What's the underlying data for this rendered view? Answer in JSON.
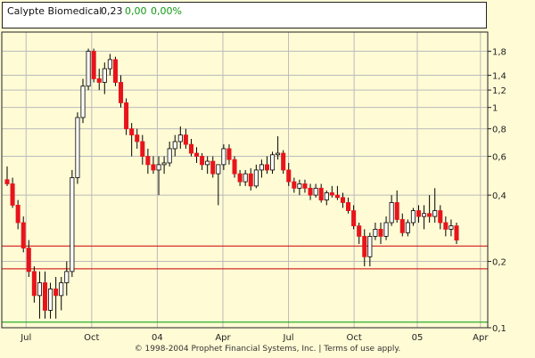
{
  "header": {
    "name": "Calypte Biomedical",
    "price": "0,23",
    "change": "0,00",
    "percent": "0,00%"
  },
  "footer": {
    "copyright": "© 1998-2004 Prophet Financial Systems, Inc. | Terms of use apply."
  },
  "colors": {
    "background": "#fffbd5",
    "up": "#ffffff",
    "down": "#e8141b",
    "gridline": "#bbbbbb",
    "red_line": "#cc0000",
    "green_line": "#009900"
  },
  "chart_data": {
    "type": "candlestick",
    "y_scale": "log",
    "ylim": [
      0.1,
      2.2
    ],
    "y_ticks": [
      {
        "v": 1.8,
        "label": "1,8"
      },
      {
        "v": 1.4,
        "label": "1,4"
      },
      {
        "v": 1.2,
        "label": "1,2"
      },
      {
        "v": 1,
        "label": "1"
      },
      {
        "v": 0.8,
        "label": "0,8"
      },
      {
        "v": 0.6,
        "label": "0,6"
      },
      {
        "v": 0.4,
        "label": "0,4"
      },
      {
        "v": 0.2,
        "label": "0,2"
      },
      {
        "v": 0.1,
        "label": "0,1"
      }
    ],
    "x_ticks": [
      {
        "pos": 0.05,
        "label": "Jul"
      },
      {
        "pos": 0.185,
        "label": "Oct"
      },
      {
        "pos": 0.32,
        "label": "04"
      },
      {
        "pos": 0.455,
        "label": "Apr"
      },
      {
        "pos": 0.59,
        "label": "Jul"
      },
      {
        "pos": 0.725,
        "label": "Oct"
      },
      {
        "pos": 0.855,
        "label": "05"
      },
      {
        "pos": 0.985,
        "label": "Apr"
      }
    ],
    "hlines": [
      {
        "value": 0.235,
        "color": "#cc0000"
      },
      {
        "value": 0.185,
        "color": "#cc0000"
      },
      {
        "value": 0.106,
        "color": "#009900"
      }
    ],
    "candles": [
      [
        0.47,
        0.54,
        0.44,
        0.45
      ],
      [
        0.45,
        0.48,
        0.35,
        0.36
      ],
      [
        0.36,
        0.38,
        0.28,
        0.3
      ],
      [
        0.3,
        0.32,
        0.22,
        0.23
      ],
      [
        0.23,
        0.25,
        0.17,
        0.18
      ],
      [
        0.18,
        0.19,
        0.13,
        0.14
      ],
      [
        0.14,
        0.18,
        0.11,
        0.16
      ],
      [
        0.16,
        0.18,
        0.11,
        0.12
      ],
      [
        0.12,
        0.16,
        0.11,
        0.15
      ],
      [
        0.15,
        0.17,
        0.11,
        0.14
      ],
      [
        0.14,
        0.17,
        0.12,
        0.16
      ],
      [
        0.16,
        0.2,
        0.14,
        0.18
      ],
      [
        0.18,
        0.52,
        0.17,
        0.48
      ],
      [
        0.48,
        0.95,
        0.45,
        0.9
      ],
      [
        0.9,
        1.35,
        0.85,
        1.25
      ],
      [
        1.25,
        1.85,
        1.2,
        1.8
      ],
      [
        1.8,
        1.85,
        1.3,
        1.35
      ],
      [
        1.35,
        1.5,
        1.2,
        1.3
      ],
      [
        1.3,
        1.6,
        1.15,
        1.5
      ],
      [
        1.5,
        1.75,
        1.4,
        1.65
      ],
      [
        1.65,
        1.7,
        1.25,
        1.3
      ],
      [
        1.3,
        1.4,
        1.0,
        1.05
      ],
      [
        1.05,
        1.1,
        0.75,
        0.8
      ],
      [
        0.8,
        0.85,
        0.6,
        0.75
      ],
      [
        0.75,
        0.8,
        0.65,
        0.7
      ],
      [
        0.7,
        0.75,
        0.55,
        0.6
      ],
      [
        0.6,
        0.65,
        0.5,
        0.55
      ],
      [
        0.55,
        0.6,
        0.5,
        0.52
      ],
      [
        0.52,
        0.6,
        0.4,
        0.55
      ],
      [
        0.55,
        0.6,
        0.5,
        0.56
      ],
      [
        0.56,
        0.7,
        0.54,
        0.65
      ],
      [
        0.65,
        0.75,
        0.6,
        0.7
      ],
      [
        0.7,
        0.82,
        0.65,
        0.75
      ],
      [
        0.75,
        0.8,
        0.65,
        0.68
      ],
      [
        0.68,
        0.72,
        0.6,
        0.62
      ],
      [
        0.62,
        0.66,
        0.56,
        0.6
      ],
      [
        0.6,
        0.62,
        0.52,
        0.55
      ],
      [
        0.55,
        0.6,
        0.5,
        0.57
      ],
      [
        0.57,
        0.6,
        0.48,
        0.5
      ],
      [
        0.5,
        0.52,
        0.36,
        0.55
      ],
      [
        0.55,
        0.68,
        0.52,
        0.65
      ],
      [
        0.65,
        0.68,
        0.55,
        0.58
      ],
      [
        0.58,
        0.6,
        0.48,
        0.5
      ],
      [
        0.5,
        0.52,
        0.44,
        0.46
      ],
      [
        0.46,
        0.52,
        0.44,
        0.5
      ],
      [
        0.5,
        0.53,
        0.42,
        0.44
      ],
      [
        0.44,
        0.55,
        0.43,
        0.52
      ],
      [
        0.52,
        0.58,
        0.48,
        0.55
      ],
      [
        0.55,
        0.6,
        0.5,
        0.52
      ],
      [
        0.52,
        0.63,
        0.5,
        0.61
      ],
      [
        0.61,
        0.74,
        0.58,
        0.62
      ],
      [
        0.62,
        0.64,
        0.5,
        0.52
      ],
      [
        0.52,
        0.56,
        0.44,
        0.46
      ],
      [
        0.46,
        0.48,
        0.41,
        0.43
      ],
      [
        0.43,
        0.47,
        0.4,
        0.45
      ],
      [
        0.45,
        0.47,
        0.41,
        0.43
      ],
      [
        0.43,
        0.45,
        0.38,
        0.4
      ],
      [
        0.4,
        0.45,
        0.39,
        0.43
      ],
      [
        0.43,
        0.45,
        0.37,
        0.38
      ],
      [
        0.38,
        0.42,
        0.36,
        0.41
      ],
      [
        0.41,
        0.44,
        0.39,
        0.4
      ],
      [
        0.4,
        0.44,
        0.38,
        0.39
      ],
      [
        0.39,
        0.41,
        0.35,
        0.37
      ],
      [
        0.37,
        0.39,
        0.33,
        0.34
      ],
      [
        0.34,
        0.36,
        0.28,
        0.29
      ],
      [
        0.29,
        0.3,
        0.24,
        0.26
      ],
      [
        0.26,
        0.28,
        0.19,
        0.21
      ],
      [
        0.21,
        0.27,
        0.19,
        0.26
      ],
      [
        0.26,
        0.3,
        0.25,
        0.28
      ],
      [
        0.28,
        0.3,
        0.24,
        0.26
      ],
      [
        0.26,
        0.32,
        0.25,
        0.3
      ],
      [
        0.3,
        0.4,
        0.29,
        0.37
      ],
      [
        0.37,
        0.42,
        0.3,
        0.31
      ],
      [
        0.31,
        0.33,
        0.26,
        0.27
      ],
      [
        0.27,
        0.31,
        0.26,
        0.3
      ],
      [
        0.3,
        0.35,
        0.29,
        0.34
      ],
      [
        0.34,
        0.36,
        0.3,
        0.32
      ],
      [
        0.32,
        0.36,
        0.28,
        0.33
      ],
      [
        0.33,
        0.4,
        0.3,
        0.32
      ],
      [
        0.32,
        0.43,
        0.3,
        0.34
      ],
      [
        0.34,
        0.36,
        0.28,
        0.3
      ],
      [
        0.3,
        0.32,
        0.26,
        0.28
      ],
      [
        0.28,
        0.31,
        0.26,
        0.29
      ],
      [
        0.29,
        0.3,
        0.24,
        0.25
      ]
    ]
  }
}
